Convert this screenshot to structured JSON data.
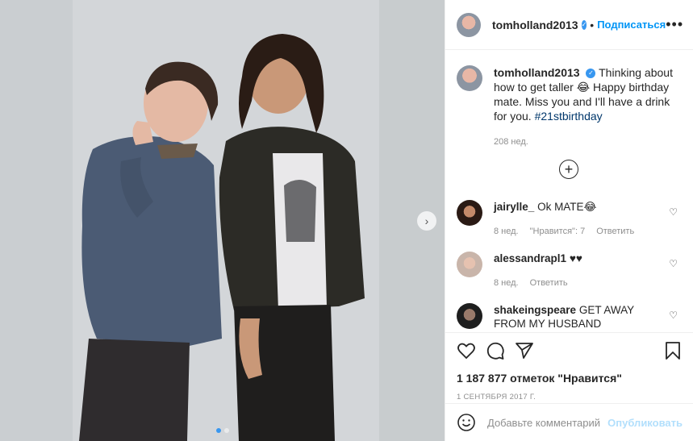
{
  "post": {
    "username": "tomholland2013",
    "follow_label": "Подписаться",
    "separator": "•",
    "more_label": "•••"
  },
  "caption": {
    "username": "tomholland2013",
    "text_main": "Thinking about how to get taller 😂 Happy birthday mate. Miss you and I'll have a drink for you. ",
    "hashtag": "#21stbirthday",
    "age": "208 нед."
  },
  "load_more": "+",
  "comments": [
    {
      "username": "jairylle_",
      "text": "Ok MATE😂",
      "age": "8 нед.",
      "likes": "\"Нравится\": 7",
      "reply": "Ответить"
    },
    {
      "username": "alessandrapl1",
      "text": "♥♥",
      "age": "8 нед.",
      "likes": "",
      "reply": "Ответить"
    },
    {
      "username": "shakeingspeare",
      "text": "GET AWAY FROM MY HUSBAND",
      "age": "",
      "likes": "",
      "reply": ""
    }
  ],
  "stats": {
    "likes": "1 187 877 отметок \"Нравится\"",
    "date": "1 СЕНТЯБРЯ 2017 Г."
  },
  "add_comment": {
    "placeholder": "Добавьте комментарий...",
    "publish_label": "Опубликовать"
  },
  "carousel": {
    "dots": 2,
    "active_index": 0,
    "next_label": "›"
  },
  "colors": {
    "accent": "#0095f6",
    "verified": "#3897f0",
    "muted": "#8e8e8e"
  }
}
